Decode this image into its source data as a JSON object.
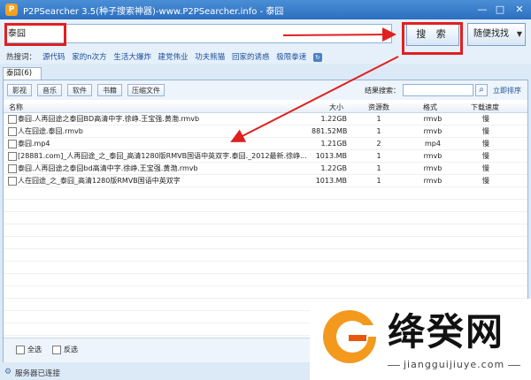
{
  "window": {
    "title": "P2PSearcher 3.5(种子搜索神器)-www.P2PSearcher.info - 泰囧",
    "app_icon_glyph": "P",
    "minimize": "—",
    "maximize": "□",
    "close": "✕"
  },
  "search": {
    "value": "泰囧",
    "button_label": "搜 索",
    "random_label": "随便找找",
    "random_arrow": "▼"
  },
  "hot": {
    "label": "热搜词：",
    "links": [
      "源代码",
      "家的n次方",
      "生活大爆炸",
      "建党伟业",
      "功夫熊猫",
      "回家的诱惑",
      "极限拳速"
    ],
    "refresh_icon": "refresh-icon"
  },
  "tab": {
    "label": "泰囧(6)"
  },
  "filters": [
    "影视",
    "音乐",
    "软件",
    "书籍",
    "压缩文件"
  ],
  "result_search": {
    "label": "结果搜索：",
    "sort_label": "立即排序"
  },
  "columns": {
    "name": "名称",
    "size": "大小",
    "sources": "资源数",
    "format": "格式",
    "speed": "下载速度"
  },
  "rows": [
    {
      "name": "泰囧.人再囧途之泰囧BD高清中字.徐峥.王宝强.黄渤.rmvb",
      "size": "1.22GB",
      "sources": "1",
      "format": "rmvb",
      "speed": "慢"
    },
    {
      "name": "人在囧途.泰囧.rmvb",
      "size": "881.52MB",
      "sources": "1",
      "format": "rmvb",
      "speed": "慢"
    },
    {
      "name": "泰囧.mp4",
      "size": "1.21GB",
      "sources": "2",
      "format": "mp4",
      "speed": "慢"
    },
    {
      "name": "[28881.com]_人再囧途_之_泰囧_高清1280版RMVB国语中英双字.泰囧._2012最新.徐峥...",
      "size": "1013.MB",
      "sources": "1",
      "format": "rmvb",
      "speed": "慢"
    },
    {
      "name": "泰囧.人再囧途之泰囧bd高清中字.徐峥.王宝强.黄渤.rmvb",
      "size": "1.22GB",
      "sources": "1",
      "format": "rmvb",
      "speed": "慢"
    },
    {
      "name": "人在囧途_之_泰囧_高清1280版RMVB国语中英双字",
      "size": "1013.MB",
      "sources": "1",
      "format": "rmvb",
      "speed": "慢"
    }
  ],
  "bottom": {
    "select_all": "全选",
    "invert": "反选"
  },
  "status": {
    "text": "服务器已连接",
    "icon": "connection-icon"
  },
  "watermark": {
    "title": "绛癸网",
    "url": "jiangguijiuye.com"
  },
  "colors": {
    "annotation_red": "#e02020",
    "title_bar": "#2c6fc0",
    "link_blue": "#1a4f9a",
    "watermark_orange": "#f39a1e"
  }
}
